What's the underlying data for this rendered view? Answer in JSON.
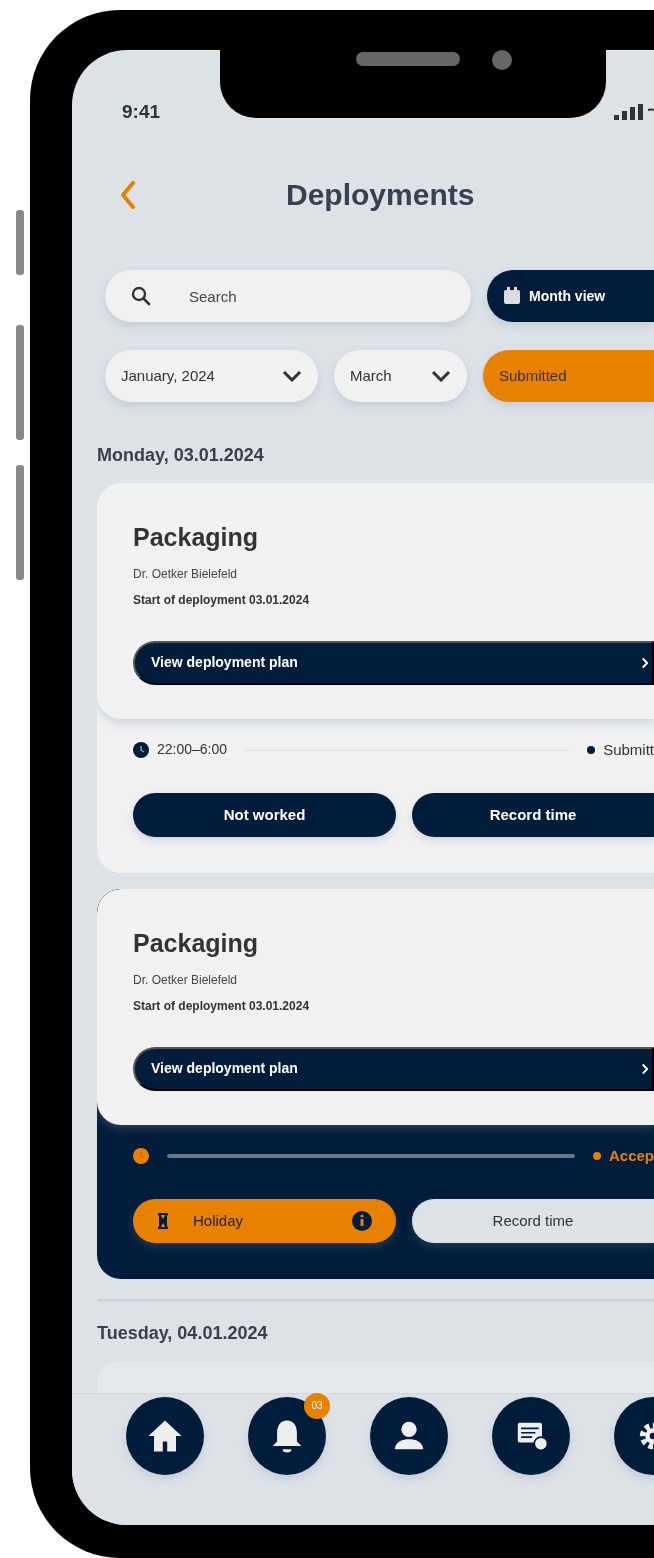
{
  "status_bar": {
    "time": "9:41"
  },
  "header": {
    "title": "Deployments"
  },
  "search": {
    "placeholder": "Search"
  },
  "view_button": {
    "label": "Month view"
  },
  "filters": [
    {
      "kind": "dropdown",
      "label": "January, 2024"
    },
    {
      "kind": "dropdown",
      "label": "March"
    },
    {
      "kind": "status",
      "label": "Submitted"
    }
  ],
  "days": [
    {
      "heading": "Monday, 03.01.2024",
      "deployments": [
        {
          "title": "Packaging",
          "company": "Dr. Oetker Bielefeld",
          "start": "Start of deployment 03.01.2024",
          "plan_button": "View deployment plan",
          "kind": "submitted",
          "time": "22:00–6:00",
          "status_label": "Submitt",
          "actions": [
            {
              "kind": "dark",
              "label": "Not worked"
            },
            {
              "kind": "dark",
              "label": "Record time"
            }
          ]
        },
        {
          "title": "Packaging",
          "company": "Dr. Oetker Bielefeld",
          "start": "Start of deployment 03.01.2024",
          "plan_button": "View deployment plan",
          "kind": "accepted",
          "status_label": "Accep",
          "actions": [
            {
              "kind": "holiday",
              "label": "Holiday"
            },
            {
              "kind": "light",
              "label": "Record time"
            }
          ]
        }
      ]
    },
    {
      "heading": "Tuesday, 04.01.2024"
    }
  ],
  "nav": [
    {
      "kind": "home"
    },
    {
      "kind": "bell",
      "badge": "03"
    },
    {
      "kind": "user"
    },
    {
      "kind": "document"
    },
    {
      "kind": "gear"
    }
  ]
}
